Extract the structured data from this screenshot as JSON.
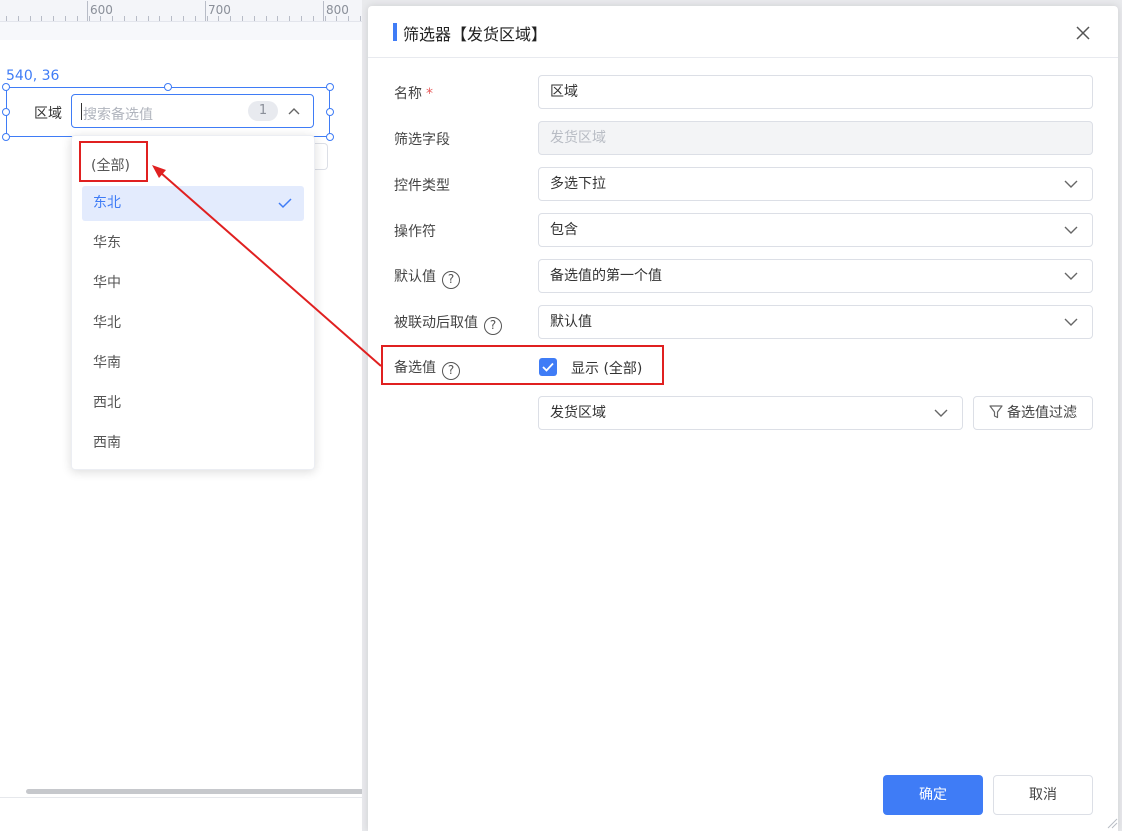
{
  "ruler": {
    "ticks": [
      "600",
      "700",
      "800"
    ]
  },
  "canvas": {
    "coordinates": "540, 36",
    "widget_label": "区域",
    "search_placeholder": "搜索备选值",
    "selected_count": "1"
  },
  "dropdown": {
    "all_option": "(全部)",
    "items": [
      "东北",
      "华东",
      "华中",
      "华北",
      "华南",
      "西北",
      "西南"
    ],
    "selected_item": "东北"
  },
  "dialog": {
    "title": "筛选器【发货区域】",
    "fields": {
      "name_label": "名称",
      "name_value": "区域",
      "filter_field_label": "筛选字段",
      "filter_field_value": "发货区域",
      "control_type_label": "控件类型",
      "control_type_value": "多选下拉",
      "operator_label": "操作符",
      "operator_value": "包含",
      "default_label": "默认值",
      "default_value": "备选值的第一个值",
      "linked_label": "被联动后取值",
      "linked_value": "默认值",
      "options_label": "备选值",
      "show_all_label": "显示 (全部)",
      "show_all_checked": true,
      "source_value": "发货区域",
      "filter_button": "备选值过滤"
    },
    "ok_button": "确定",
    "cancel_button": "取消"
  },
  "colors": {
    "accent": "#3f7cf6",
    "highlight_red": "#e02020"
  }
}
